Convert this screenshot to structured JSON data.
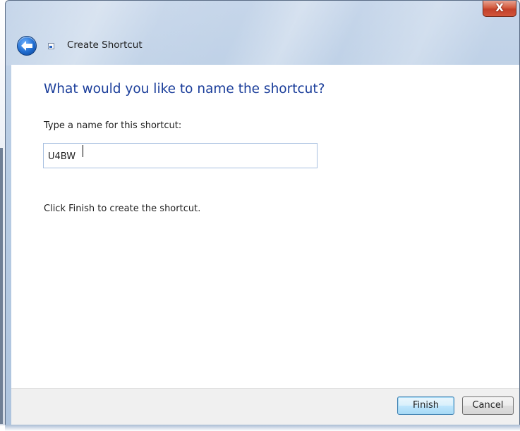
{
  "window": {
    "close_glyph": "X"
  },
  "header": {
    "title": "Create Shortcut",
    "back_icon": "back-arrow-icon",
    "shortcut_icon": "shortcut-icon"
  },
  "main": {
    "question": "What would you like to name the shortcut?",
    "name_label": "Type a name for this shortcut:",
    "name_value": "U4BW",
    "hint": "Click Finish to create the shortcut."
  },
  "footer": {
    "finish_label": "Finish",
    "cancel_label": "Cancel"
  },
  "colors": {
    "heading": "#1a3d9a",
    "close_button": "#c3412a",
    "default_button_border": "#3c7fb1"
  }
}
